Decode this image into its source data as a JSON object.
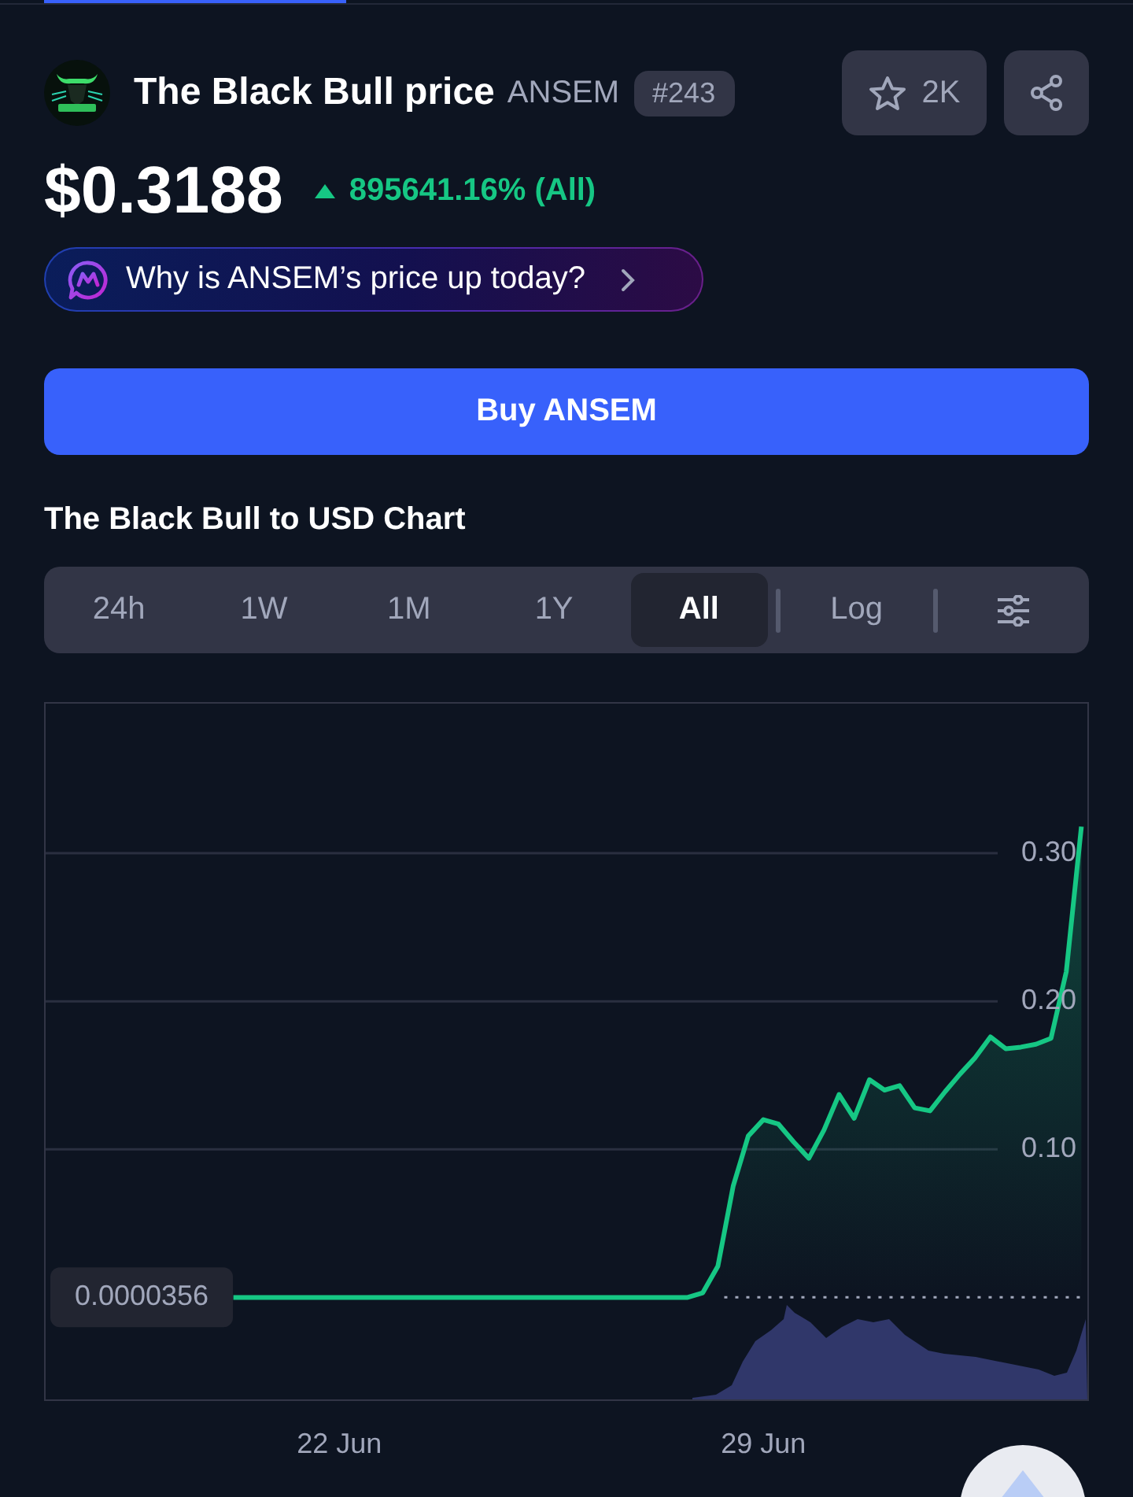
{
  "header": {
    "name": "The Black Bull price",
    "symbol": "ANSEM",
    "rank": "#243",
    "watchlist_count": "2K"
  },
  "price": {
    "value": "$0.3188",
    "change": "895641.16% (All)"
  },
  "ai_prompt": {
    "label": "Why is ANSEM’s price up today?"
  },
  "buy_button": {
    "label": "Buy ANSEM"
  },
  "chart_section": {
    "title": "The Black Bull to USD Chart",
    "ranges": [
      {
        "label": "24h",
        "selected": false
      },
      {
        "label": "1W",
        "selected": false
      },
      {
        "label": "1M",
        "selected": false
      },
      {
        "label": "1Y",
        "selected": false
      },
      {
        "label": "All",
        "selected": true
      }
    ],
    "log": {
      "label": "Log",
      "on": false
    },
    "chart_data": {
      "type": "area",
      "grid": true,
      "categories": [
        null,
        null,
        null,
        null,
        null,
        null,
        null,
        null,
        null,
        null,
        null,
        null,
        null,
        null,
        null,
        null,
        null,
        null,
        null,
        "22 Jun",
        null,
        null,
        null,
        null,
        null,
        null,
        null,
        null,
        null,
        null,
        null,
        null,
        null,
        null,
        null,
        null,
        null,
        null,
        null,
        null,
        null,
        null,
        null,
        null,
        null,
        null,
        null,
        "29 Jun",
        null,
        null,
        null,
        null,
        null,
        null,
        null,
        null,
        null,
        null,
        null,
        null,
        null,
        null,
        null,
        null,
        null,
        null,
        null,
        null,
        null
      ],
      "series": [
        {
          "color": "#16c784",
          "values": [
            null,
            null,
            null,
            null,
            null,
            null,
            null,
            null,
            null,
            null,
            null,
            null,
            0,
            0,
            0,
            0,
            0,
            0,
            0,
            0,
            0,
            0,
            0,
            0,
            0,
            0,
            0,
            0,
            0,
            0,
            0,
            0,
            0,
            0,
            0,
            0,
            0,
            0,
            0,
            0,
            0,
            0,
            0,
            0.003,
            0.021,
            0.075,
            0.109,
            0.12,
            0.117,
            0.105,
            0.094,
            0.113,
            0.137,
            0.121,
            0.147,
            0.14,
            0.143,
            0.128,
            0.126,
            0.139,
            0.151,
            0.162,
            0.176,
            0.168,
            0.169,
            0.171,
            0.175,
            0.22,
            0.318
          ]
        }
      ],
      "ylim": [
        -0.07,
        0.4
      ],
      "yticks": [
        {
          "value": 0.1,
          "label": "0.10"
        },
        {
          "value": 0.2,
          "label": "0.20"
        },
        {
          "value": 0.3,
          "label": "0.30"
        }
      ],
      "ref_lines": [
        {
          "axis": "y",
          "value": 3.56e-05,
          "label": "0.0000356"
        }
      ]
    }
  }
}
